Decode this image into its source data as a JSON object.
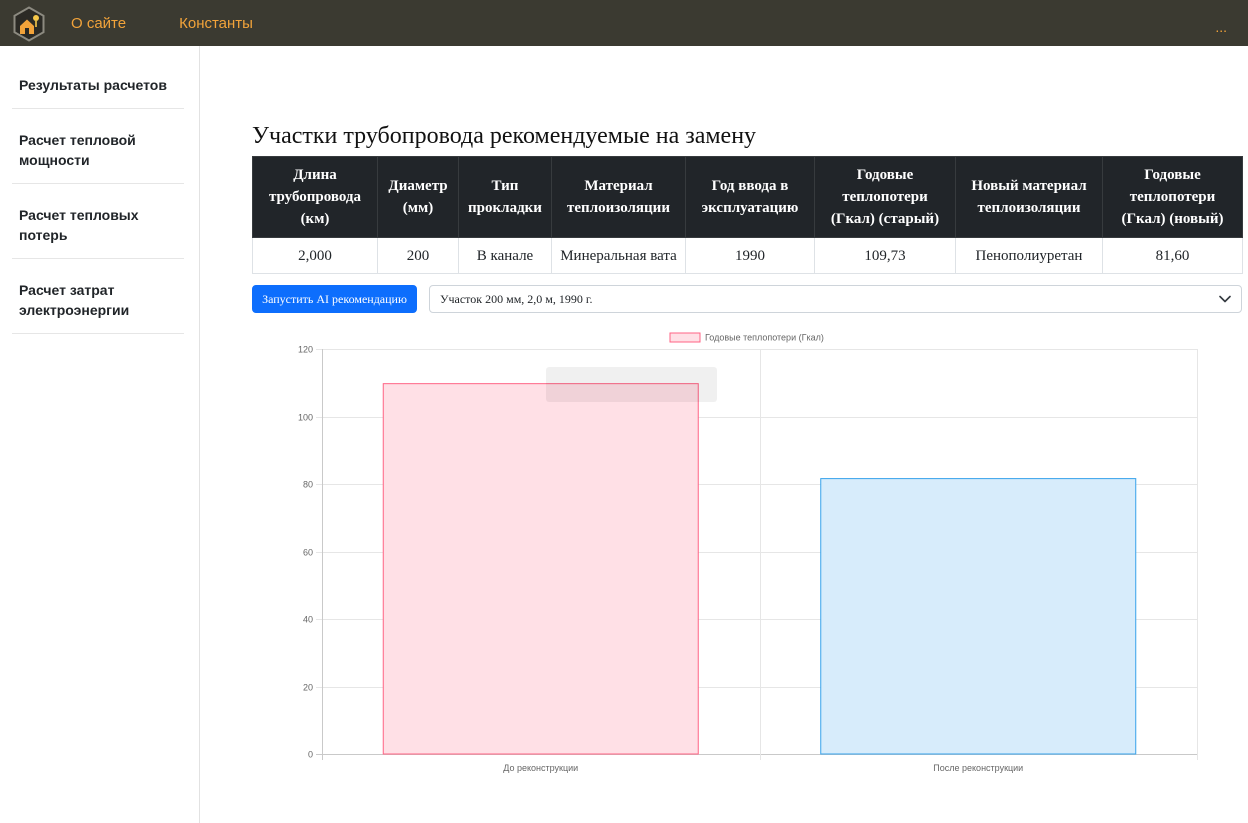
{
  "theme": {
    "navbar_bg": "#3b3a31",
    "nav_link": "#f2a33a",
    "primary_button": "#0d6efd",
    "table_header_bg": "#212529"
  },
  "icons": {
    "brand": "logo-icon",
    "select_toggle": "chevron-down-icon"
  },
  "nav": {
    "links": [
      {
        "label": "О сайте"
      },
      {
        "label": "Константы"
      }
    ],
    "more_label": "..."
  },
  "sidebar": {
    "items": [
      {
        "label": "Результаты расчетов"
      },
      {
        "label": "Расчет тепловой мощности"
      },
      {
        "label": "Расчет тепловых потерь"
      },
      {
        "label": "Расчет затрат электроэнергии"
      }
    ]
  },
  "main": {
    "title": "Участки трубопровода рекомендуемые на замену",
    "table": {
      "headers": [
        "Длина трубопровода (км)",
        "Диаметр (мм)",
        "Тип прокладки",
        "Материал теплоизоляции",
        "Год ввода в эксплуатацию",
        "Годовые теплопотери (Гкал) (старый)",
        "Новый материал теплоизоляции",
        "Годовые теплопотери (Гкал) (новый)"
      ],
      "rows": [
        [
          "2,000",
          "200",
          "В канале",
          "Минеральная вата",
          "1990",
          "109,73",
          "Пенополиуретан",
          "81,60"
        ]
      ]
    },
    "ai_button_label": "Запустить AI рекомендацию",
    "segment_select": {
      "selected": "Участок 200 мм, 2,0 м, 1990 г."
    }
  },
  "chart_data": {
    "type": "bar",
    "categories": [
      "До реконструкции",
      "После реконструкции"
    ],
    "series": [
      {
        "name": "Годовые теплопотери (Гкал)",
        "values": [
          109.73,
          81.6
        ]
      }
    ],
    "ylim": [
      0,
      120
    ],
    "yticks": [
      "0",
      "20",
      "40",
      "60",
      "80",
      "100",
      "120"
    ],
    "legend": "top",
    "grid": true,
    "colors": {
      "fill": [
        "#ffe0e6",
        "#d7ecfb"
      ],
      "border": [
        "#ff6384",
        "#36a2eb"
      ]
    }
  }
}
